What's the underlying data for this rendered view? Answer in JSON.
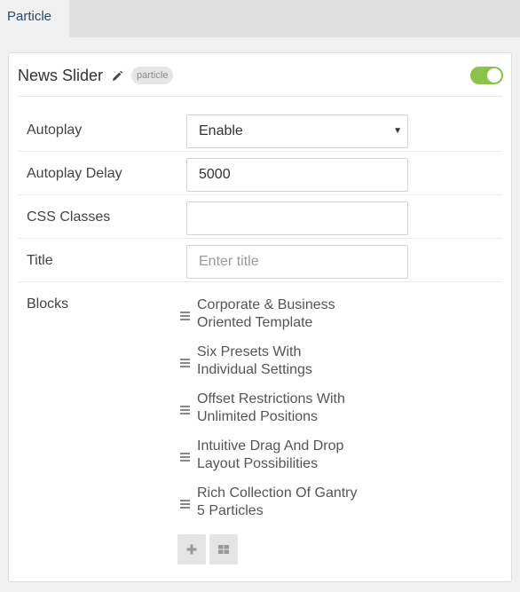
{
  "tabs": [
    {
      "label": "Particle"
    }
  ],
  "panel": {
    "title": "News Slider",
    "badge": "particle",
    "enabled": true
  },
  "fields": {
    "autoplay": {
      "label": "Autoplay",
      "value": "Enable"
    },
    "autoplay_delay": {
      "label": "Autoplay Delay",
      "value": "5000"
    },
    "css_classes": {
      "label": "CSS Classes",
      "value": ""
    },
    "title": {
      "label": "Title",
      "placeholder": "Enter title"
    }
  },
  "blocks": {
    "label": "Blocks",
    "items": [
      {
        "line1": "Corporate & Business",
        "line2": "Oriented Template"
      },
      {
        "line1": "Six Presets With",
        "line2": "Individual Settings"
      },
      {
        "line1": "Offset Restrictions With",
        "line2": "Unlimited Positions"
      },
      {
        "line1": "Intuitive Drag And Drop",
        "line2": "Layout Possibilities"
      },
      {
        "line1": "Rich Collection Of Gantry",
        "line2": "5 Particles"
      }
    ]
  },
  "icons": {
    "edit": "pencil-icon",
    "drag": "drag-handle-icon",
    "add": "plus-icon",
    "grid": "grid-icon"
  },
  "colors": {
    "toggle_on": "#8bc34a",
    "tab_text": "#2a4b6e"
  }
}
